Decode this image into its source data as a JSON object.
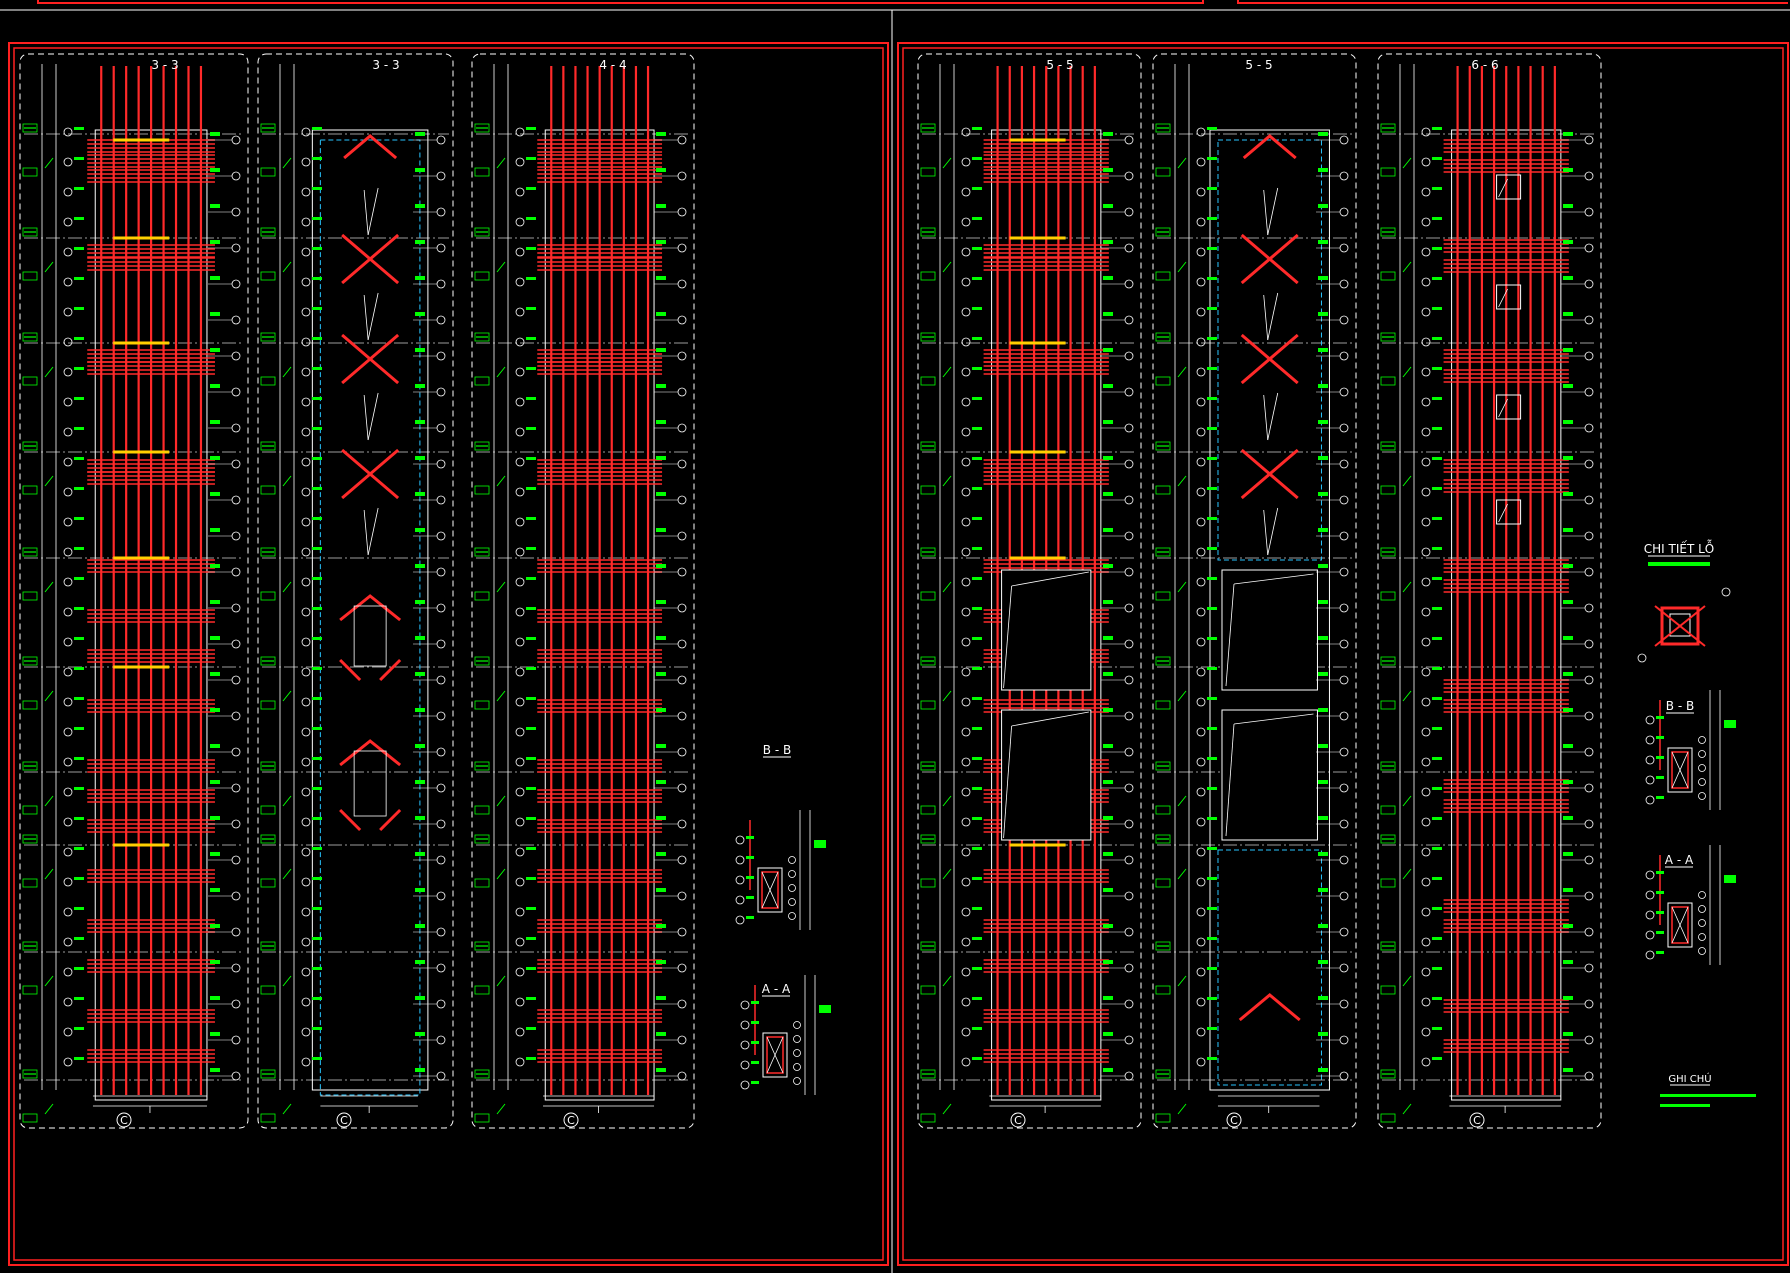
{
  "sheets": [
    {
      "sections": [
        {
          "label": "3 - 3",
          "grid": "C",
          "type": "rebar-dense"
        },
        {
          "label": "3 - 3",
          "grid": "C",
          "type": "openings"
        },
        {
          "label": "4 - 4",
          "grid": "C",
          "type": "rebar-plain"
        }
      ],
      "details": [
        {
          "label": "B - B"
        },
        {
          "label": "A - A"
        }
      ]
    },
    {
      "sections": [
        {
          "label": "5 - 5",
          "grid": "C",
          "type": "rebar-panels"
        },
        {
          "label": "5 - 5",
          "grid": "C",
          "type": "openings-panels"
        },
        {
          "label": "6 - 6",
          "grid": "C",
          "type": "rebar-holes"
        }
      ],
      "details": [
        {
          "label": "CHI TIẾT LỖ"
        },
        {
          "label": "B - B"
        },
        {
          "label": "A - A"
        },
        {
          "label": "GHI CHÚ"
        }
      ]
    }
  ],
  "colors": {
    "frame": "#ff2020",
    "rebar": "#ff2a2a",
    "rebar_highlight": "#ffd000",
    "annotation": "#00ff00",
    "linework": "#ffffff",
    "opening_outline": "#29c5ff",
    "background": "#000000"
  }
}
